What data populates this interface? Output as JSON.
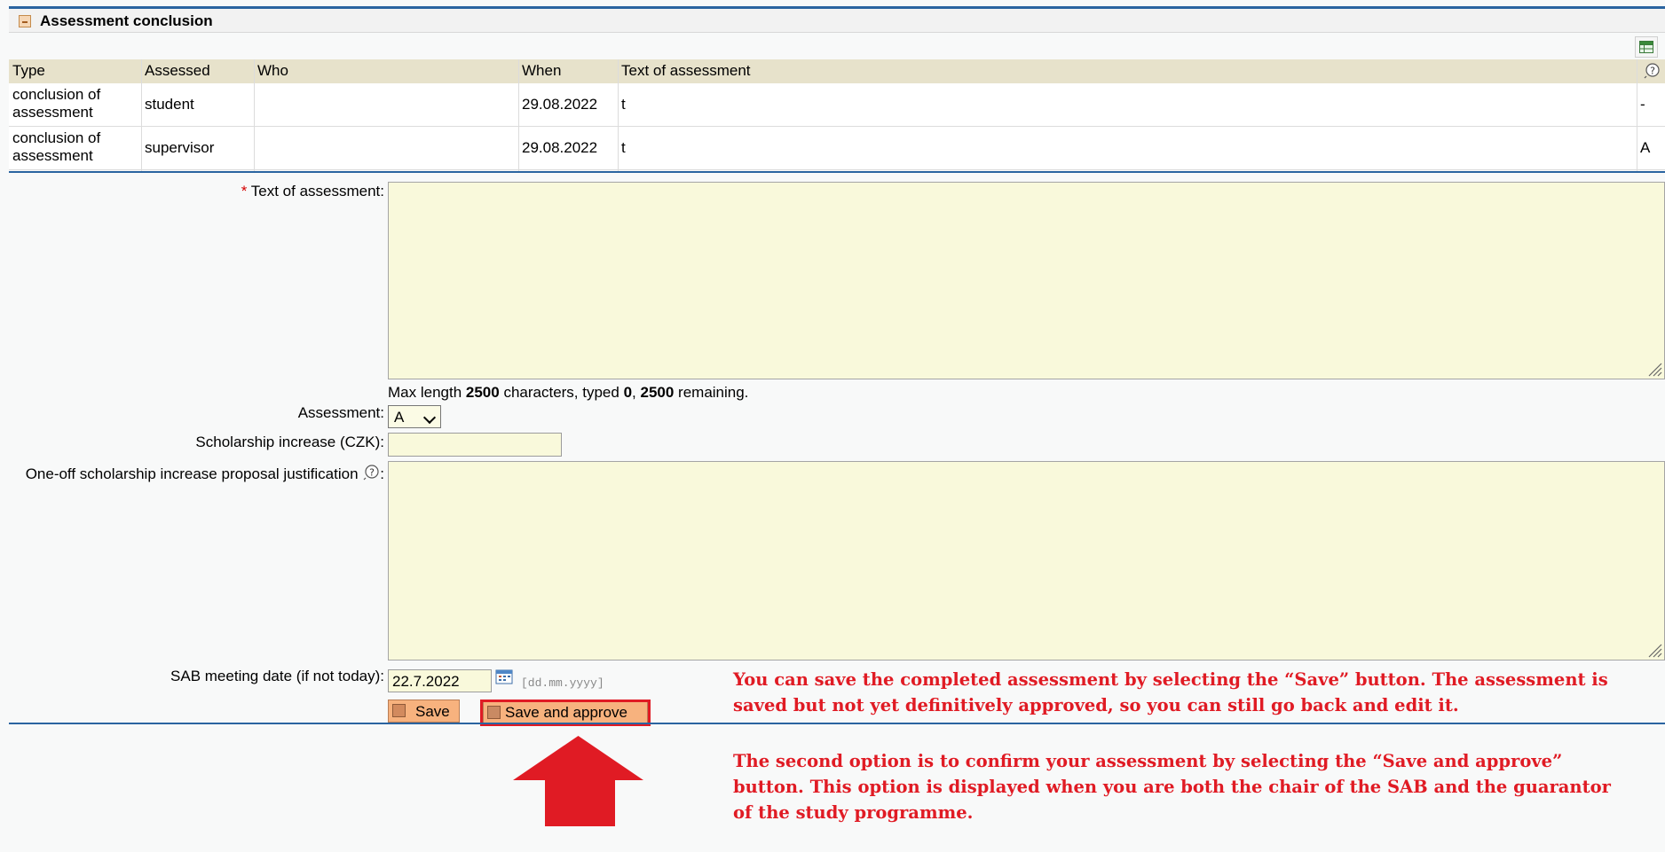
{
  "panel": {
    "title": "Assessment conclusion"
  },
  "table": {
    "columns": [
      "Type",
      "Assessed",
      "Who",
      "When",
      "Text of assessment"
    ],
    "rows": [
      {
        "type": "conclusion of assessment",
        "assessed": "student",
        "who": "",
        "when": "29.08.2022",
        "text": "t",
        "mark": "-"
      },
      {
        "type": "conclusion of assessment",
        "assessed": "supervisor",
        "who": "",
        "when": "29.08.2022",
        "text": "t",
        "mark": "A"
      }
    ]
  },
  "form": {
    "text_label": "Text of assessment:",
    "required_mark": "*",
    "text_value": "",
    "hint": {
      "prefix": "Max length ",
      "max": "2500",
      "mid1": " characters, typed ",
      "typed": "0",
      "mid2": ", ",
      "remaining": "2500",
      "suffix": " remaining."
    },
    "assessment_label": "Assessment:",
    "assessment_value": "A",
    "scholarship_label": "Scholarship increase (CZK):",
    "scholarship_value": "",
    "justification_label": "One-off scholarship increase proposal justification",
    "justification_colon": ":",
    "sab_label": "SAB meeting date (if not today):",
    "sab_value": "22.7.2022",
    "date_format": "[dd.mm.yyyy]",
    "save_label": "Save",
    "save_approve_label": "Save and approve"
  },
  "annotations": {
    "note1": "You can save the completed assessment by selecting the “Save” button. The assessment is saved but not yet definitively approved, so you can still go back and edit it.",
    "note2": "The second option is to confirm your assessment by selecting the “Save and approve” button. This option is displayed when you are both the chair of the SAB and the guarantor of the study programme."
  },
  "colors": {
    "accent_line": "#2a64a0",
    "annotation_red": "#e01b24",
    "button_orange": "#f7b27e",
    "field_yellow": "#f9f9db",
    "table_header": "#e7e2cb"
  },
  "icons": [
    "collapse-icon",
    "excel-export-icon",
    "help-icon",
    "resize-grip-icon",
    "calendar-icon",
    "save-icon",
    "arrow-up-icon"
  ]
}
